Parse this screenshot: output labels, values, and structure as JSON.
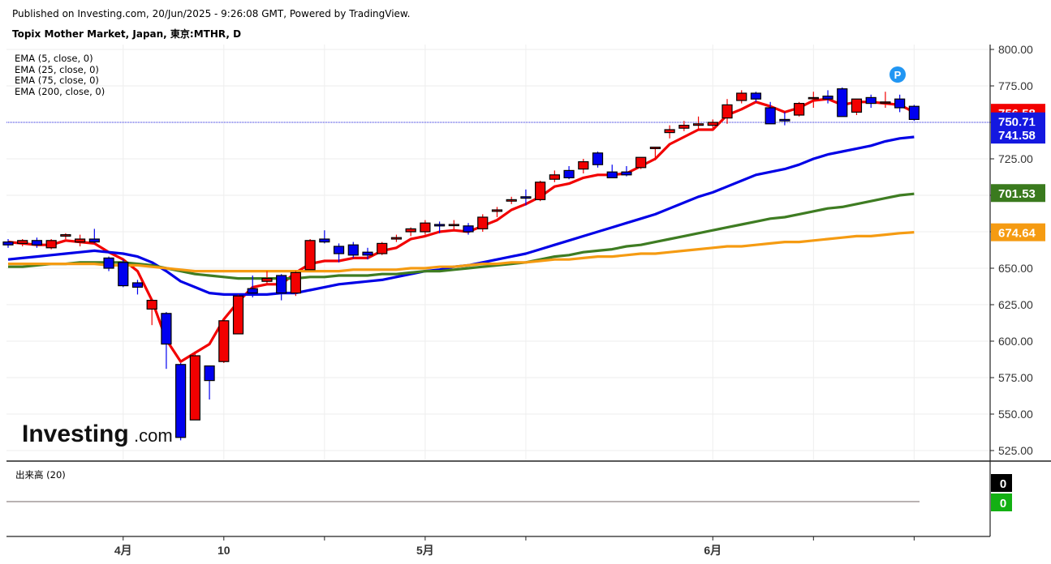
{
  "header": {
    "published": "Published on Investing.com, 20/Jun/2025 - 9:26:08 GMT, Powered by TradingView.",
    "symbol": "Topix Mother Market, Japan, 東京:MTHR, D"
  },
  "legend": [
    "EMA (5, close, 0)",
    "EMA (25, close, 0)",
    "EMA (75, close, 0)",
    "EMA (200, close, 0)"
  ],
  "volume_label": "出来高 (20)",
  "logo": {
    "text": "Investing",
    "suffix": ".com"
  },
  "p_marker": "P",
  "colors": {
    "up": "#f20000",
    "down": "#0000f0",
    "ema5": "#f20000",
    "ema25": "#0000e6",
    "ema75": "#3e7c22",
    "ema200": "#f59b12",
    "grid": "#eeeeee",
    "axis": "#222222",
    "badge_red": "#f20000",
    "badge_blue": "#1418e0",
    "badge_green": "#3a7a1e",
    "badge_orange": "#f59b12",
    "badge_black": "#000000",
    "badge_vol_green": "#13b013"
  },
  "chart_data": {
    "type": "candlestick",
    "y_ticks": [
      "800.00",
      "775.00",
      "750.00",
      "725.00",
      "700.00",
      "675.00",
      "650.00",
      "625.00",
      "600.00",
      "575.00",
      "550.00",
      "525.00"
    ],
    "ylim": [
      515,
      803
    ],
    "x_ticks": [
      {
        "bar": 8,
        "label": "4月",
        "bold": true
      },
      {
        "bar": 15,
        "label": "10",
        "bold": false
      },
      {
        "bar": 22,
        "label": "",
        "bold": false
      },
      {
        "bar": 29,
        "label": "5月",
        "bold": true
      },
      {
        "bar": 36,
        "label": "",
        "bold": false
      },
      {
        "bar": 49,
        "label": "6月",
        "bold": true
      },
      {
        "bar": 56,
        "label": "",
        "bold": false
      },
      {
        "bar": 63,
        "label": "",
        "bold": false
      }
    ],
    "candles": [
      {
        "o": 668,
        "h": 670,
        "l": 664,
        "c": 666
      },
      {
        "o": 667,
        "h": 670,
        "l": 665,
        "c": 669
      },
      {
        "o": 669,
        "h": 671,
        "l": 664,
        "c": 666
      },
      {
        "o": 664,
        "h": 670,
        "l": 663,
        "c": 669
      },
      {
        "o": 672,
        "h": 674,
        "l": 670,
        "c": 673
      },
      {
        "o": 668,
        "h": 673,
        "l": 665,
        "c": 670
      },
      {
        "o": 670,
        "h": 677,
        "l": 667,
        "c": 668
      },
      {
        "o": 657,
        "h": 658,
        "l": 648,
        "c": 650
      },
      {
        "o": 654,
        "h": 656,
        "l": 637,
        "c": 638
      },
      {
        "o": 640,
        "h": 642,
        "l": 632,
        "c": 637
      },
      {
        "o": 622,
        "h": 628,
        "l": 611,
        "c": 628
      },
      {
        "o": 619,
        "h": 620,
        "l": 581,
        "c": 598
      },
      {
        "o": 584,
        "h": 585,
        "l": 532,
        "c": 534
      },
      {
        "o": 546,
        "h": 593,
        "l": 546,
        "c": 590
      },
      {
        "o": 583,
        "h": 583,
        "l": 560,
        "c": 573
      },
      {
        "o": 586,
        "h": 616,
        "l": 585,
        "c": 614
      },
      {
        "o": 605,
        "h": 632,
        "l": 605,
        "c": 631
      },
      {
        "o": 636,
        "h": 645,
        "l": 630,
        "c": 633
      },
      {
        "o": 641,
        "h": 648,
        "l": 639,
        "c": 643
      },
      {
        "o": 645,
        "h": 646,
        "l": 628,
        "c": 633
      },
      {
        "o": 633,
        "h": 648,
        "l": 631,
        "c": 647
      },
      {
        "o": 649,
        "h": 670,
        "l": 649,
        "c": 669
      },
      {
        "o": 670,
        "h": 676,
        "l": 667,
        "c": 668
      },
      {
        "o": 665,
        "h": 667,
        "l": 654,
        "c": 660
      },
      {
        "o": 666,
        "h": 668,
        "l": 657,
        "c": 659
      },
      {
        "o": 661,
        "h": 664,
        "l": 656,
        "c": 659
      },
      {
        "o": 660,
        "h": 668,
        "l": 659,
        "c": 667
      },
      {
        "o": 670,
        "h": 673,
        "l": 668,
        "c": 671
      },
      {
        "o": 675,
        "h": 678,
        "l": 672,
        "c": 677
      },
      {
        "o": 675,
        "h": 683,
        "l": 673,
        "c": 681
      },
      {
        "o": 680,
        "h": 682,
        "l": 674,
        "c": 679
      },
      {
        "o": 680,
        "h": 683,
        "l": 676,
        "c": 680
      },
      {
        "o": 679,
        "h": 681,
        "l": 673,
        "c": 675
      },
      {
        "o": 677,
        "h": 687,
        "l": 675,
        "c": 685
      },
      {
        "o": 689,
        "h": 692,
        "l": 685,
        "c": 690
      },
      {
        "o": 696,
        "h": 699,
        "l": 694,
        "c": 697
      },
      {
        "o": 699,
        "h": 704,
        "l": 693,
        "c": 698
      },
      {
        "o": 697,
        "h": 710,
        "l": 696,
        "c": 709
      },
      {
        "o": 711,
        "h": 717,
        "l": 709,
        "c": 714
      },
      {
        "o": 717,
        "h": 720,
        "l": 711,
        "c": 712
      },
      {
        "o": 718,
        "h": 725,
        "l": 715,
        "c": 723
      },
      {
        "o": 729,
        "h": 730,
        "l": 719,
        "c": 721
      },
      {
        "o": 716,
        "h": 721,
        "l": 712,
        "c": 712
      },
      {
        "o": 716,
        "h": 720,
        "l": 713,
        "c": 714
      },
      {
        "o": 719,
        "h": 726,
        "l": 718,
        "c": 726
      },
      {
        "o": 732,
        "h": 733,
        "l": 724,
        "c": 733
      },
      {
        "o": 743,
        "h": 748,
        "l": 739,
        "c": 745
      },
      {
        "o": 746,
        "h": 751,
        "l": 744,
        "c": 748
      },
      {
        "o": 748,
        "h": 754,
        "l": 745,
        "c": 749
      },
      {
        "o": 748,
        "h": 752,
        "l": 745,
        "c": 750
      },
      {
        "o": 753,
        "h": 766,
        "l": 749,
        "c": 762
      },
      {
        "o": 765,
        "h": 772,
        "l": 763,
        "c": 770
      },
      {
        "o": 770,
        "h": 771,
        "l": 764,
        "c": 766
      },
      {
        "o": 760,
        "h": 764,
        "l": 749,
        "c": 749
      },
      {
        "o": 752,
        "h": 757,
        "l": 748,
        "c": 751
      },
      {
        "o": 755,
        "h": 764,
        "l": 754,
        "c": 763
      },
      {
        "o": 767,
        "h": 771,
        "l": 760,
        "c": 767
      },
      {
        "o": 768,
        "h": 772,
        "l": 763,
        "c": 766
      },
      {
        "o": 773,
        "h": 774,
        "l": 754,
        "c": 754
      },
      {
        "o": 757,
        "h": 766,
        "l": 755,
        "c": 766
      },
      {
        "o": 767,
        "h": 769,
        "l": 760,
        "c": 763
      },
      {
        "o": 764,
        "h": 771,
        "l": 760,
        "c": 764
      },
      {
        "o": 766,
        "h": 769,
        "l": 757,
        "c": 760
      },
      {
        "o": 761,
        "h": 762,
        "l": 751,
        "c": 752
      }
    ],
    "series": [
      {
        "name": "EMA (5, close, 0)",
        "color": "#f20000",
        "values": [
          668,
          667,
          666,
          666,
          669,
          668,
          667,
          661,
          656,
          648,
          628,
          601,
          586,
          592,
          598,
          615,
          627,
          637,
          639,
          639,
          647,
          653,
          655,
          655,
          657,
          657,
          662,
          664,
          670,
          672,
          675,
          676,
          675,
          679,
          683,
          690,
          694,
          699,
          706,
          708,
          712,
          714,
          714,
          715,
          720,
          725,
          735,
          740,
          745,
          745,
          755,
          759,
          764,
          761,
          757,
          760,
          765,
          766,
          762,
          764,
          764,
          763,
          762,
          757
        ]
      },
      {
        "name": "EMA (25, close, 0)",
        "color": "#0000e6",
        "values": [
          656,
          657,
          658,
          659,
          660,
          661,
          662,
          661,
          660,
          658,
          654,
          648,
          641,
          637,
          633,
          632,
          632,
          632,
          632,
          633,
          633,
          635,
          637,
          639,
          640,
          641,
          642,
          644,
          646,
          648,
          649,
          651,
          652,
          654,
          656,
          658,
          660,
          663,
          666,
          669,
          672,
          675,
          678,
          681,
          684,
          687,
          691,
          695,
          699,
          702,
          706,
          710,
          714,
          716,
          718,
          721,
          725,
          728,
          730,
          732,
          734,
          737,
          739,
          740
        ]
      },
      {
        "name": "EMA (75, close, 0)",
        "color": "#3e7c22",
        "values": [
          651,
          651,
          652,
          653,
          653,
          654,
          654,
          654,
          654,
          653,
          652,
          650,
          648,
          646,
          645,
          644,
          643,
          643,
          643,
          643,
          643,
          644,
          644,
          645,
          645,
          645,
          646,
          646,
          647,
          648,
          648,
          649,
          650,
          651,
          652,
          653,
          654,
          656,
          658,
          659,
          661,
          662,
          663,
          665,
          666,
          668,
          670,
          672,
          674,
          676,
          678,
          680,
          682,
          684,
          685,
          687,
          689,
          691,
          692,
          694,
          696,
          698,
          700,
          701
        ]
      },
      {
        "name": "EMA (200, close, 0)",
        "color": "#f59b12",
        "values": [
          653,
          653,
          653,
          653,
          653,
          653,
          653,
          652,
          652,
          652,
          651,
          650,
          649,
          648,
          648,
          648,
          648,
          648,
          648,
          648,
          648,
          648,
          648,
          648,
          649,
          649,
          649,
          649,
          650,
          650,
          651,
          651,
          652,
          653,
          653,
          654,
          654,
          655,
          656,
          656,
          657,
          658,
          658,
          659,
          660,
          660,
          661,
          662,
          663,
          664,
          665,
          665,
          666,
          667,
          668,
          668,
          669,
          670,
          671,
          672,
          672,
          673,
          674,
          674.64
        ]
      }
    ],
    "price_line": 750,
    "last_labels": [
      {
        "text": "756.58",
        "value": 756.58,
        "color": "#f20000"
      },
      {
        "text": "750.71",
        "value": 750.71,
        "color": "#1418e0"
      },
      {
        "text": "741.58",
        "value": 741.58,
        "color": "#1418e0"
      },
      {
        "text": "701.53",
        "value": 701.53,
        "color": "#3a7a1e"
      },
      {
        "text": "674.64",
        "value": 674.64,
        "color": "#f59b12"
      }
    ],
    "volume_labels": [
      {
        "text": "0",
        "color": "#000000"
      },
      {
        "text": "0",
        "color": "#13b013"
      }
    ]
  }
}
